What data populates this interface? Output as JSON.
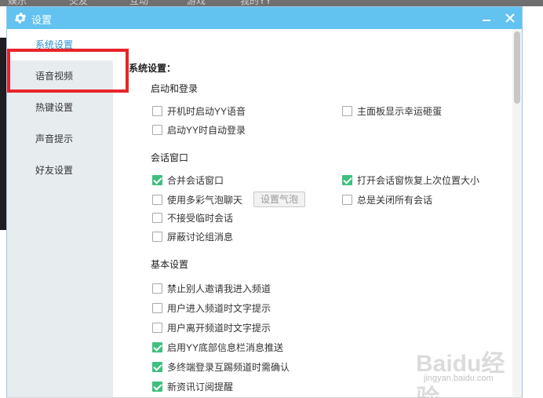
{
  "background_app": {
    "tabs": [
      "娱乐",
      "交友",
      "互动",
      "游戏",
      "我的YY"
    ]
  },
  "dialog": {
    "title": "设置",
    "minimize_icon": "minimize-icon",
    "close_icon": "close-icon",
    "sidebar": {
      "items": [
        {
          "label": "系统设置",
          "active": true
        },
        {
          "label": "语音视频",
          "active": false
        },
        {
          "label": "热键设置",
          "active": false
        },
        {
          "label": "声音提示",
          "active": false
        },
        {
          "label": "好友设置",
          "active": false
        }
      ]
    },
    "content": {
      "page_title": "系统设置：",
      "sections": [
        {
          "title": "启动和登录",
          "options": [
            {
              "label": "开机时启动YY语音",
              "checked": false
            },
            {
              "label": "主面板显示幸运砸蛋",
              "checked": false
            },
            {
              "label": "启动YY时自动登录",
              "checked": false
            }
          ]
        },
        {
          "title": "会话窗口",
          "options": [
            {
              "label": "合并会话窗口",
              "checked": true
            },
            {
              "label": "打开会话窗恢复上次位置大小",
              "checked": true
            },
            {
              "label": "使用多彩气泡聊天",
              "checked": false
            },
            {
              "label": "总是关闭所有会话",
              "checked": false
            },
            {
              "label": "不接受临时会话",
              "checked": false
            },
            {
              "label": "屏蔽讨论组消息",
              "checked": false
            }
          ],
          "bubble_button": "设置气泡"
        },
        {
          "title": "基本设置",
          "options": [
            {
              "label": "禁止别人邀请我进入频道",
              "checked": false
            },
            {
              "label": "用户进入频道时文字提示",
              "checked": false
            },
            {
              "label": "用户离开频道时文字提示",
              "checked": false
            },
            {
              "label": "启用YY底部信息栏消息推送",
              "checked": true
            },
            {
              "label": "多终端登录互踢频道时需确认",
              "checked": true
            },
            {
              "label": "新资讯订阅提醒",
              "checked": true
            }
          ]
        }
      ]
    }
  },
  "watermark": {
    "logo": "Baidu经验",
    "url": "jingyan.baidu.com"
  },
  "colors": {
    "titlebar": "#62c2f0",
    "active_nav": "#2a8fd0",
    "checkbox_checked": "#3fbf7f",
    "highlight": "#e8242a"
  }
}
